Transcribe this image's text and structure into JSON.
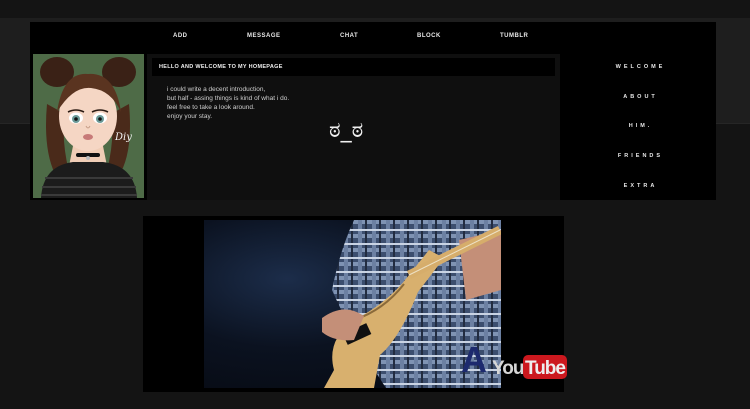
{
  "nav": {
    "items": [
      "ADD",
      "MESSAGE",
      "CHAT",
      "BLOCK",
      "TUMBLR"
    ]
  },
  "main": {
    "title": "HELLO AND WELCOME TO MY HOMEPAGE",
    "intro_lines": [
      "i could write a decent introduction,",
      "but half - assing things is kind of what i do.",
      "feel free to take a look around.",
      "enjoy your stay."
    ],
    "emoticon": "ಠ_ಠ"
  },
  "avatar": {
    "signature": "Diy"
  },
  "sidemenu": {
    "items": [
      "WELCOME",
      "ABOUT",
      "HIM.",
      "FRIENDS",
      "EXTRA"
    ]
  },
  "video": {
    "watermark_letter": "A",
    "logo_you": "You",
    "logo_tube": "Tube"
  },
  "colors": {
    "page_background": "#141414",
    "panel_background": "#000000",
    "text": "#e8e8e8",
    "youtube_red": "#cc181e"
  }
}
